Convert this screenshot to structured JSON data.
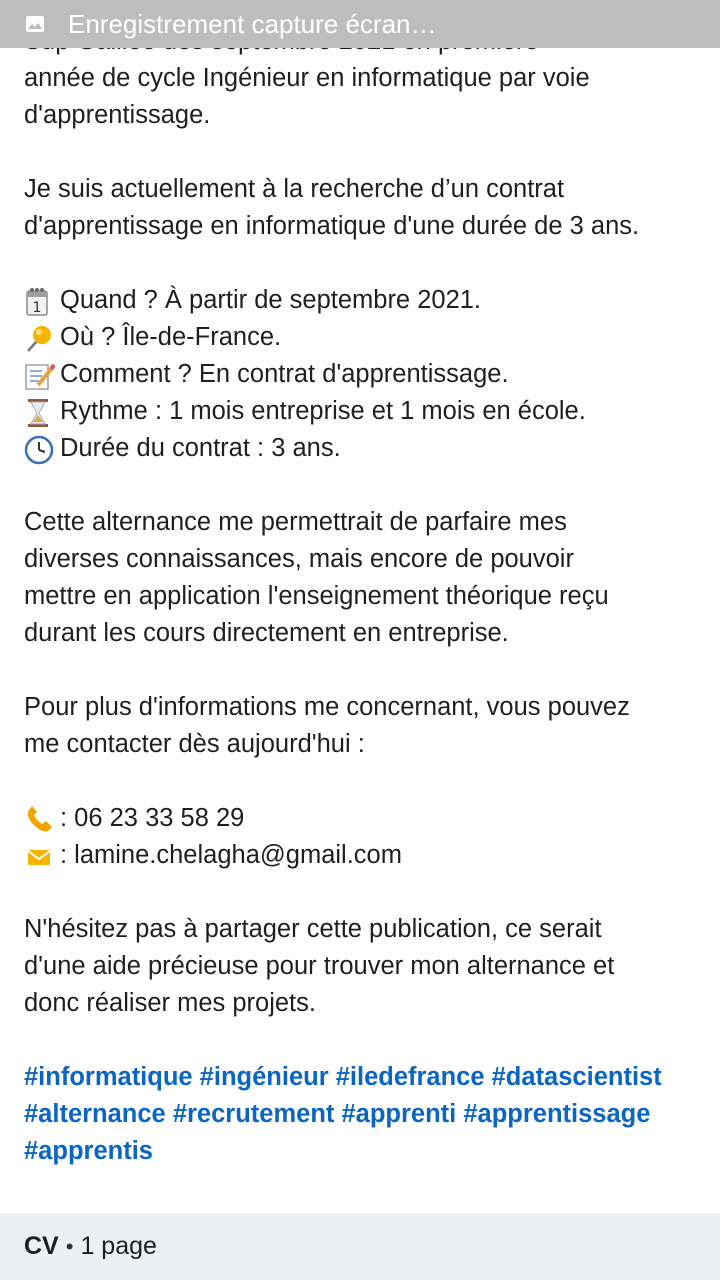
{
  "notification": {
    "icon": "image-icon",
    "title": "Enregistrement capture écran…"
  },
  "post": {
    "lines": [
      "Sup Galilée dés septembre 2021 en première",
      "année de cycle Ingénieur en informatique par voie",
      "d'apprentissage.",
      "Je suis actuellement à la recherche d’un contrat",
      "d'apprentissage en informatique d'une durée de 3 ans."
    ],
    "details": [
      {
        "icon": "calendar-icon",
        "text": "Quand ? À partir de septembre 2021."
      },
      {
        "icon": "pushpin-icon",
        "text": "Où ? Île-de-France."
      },
      {
        "icon": "memo-icon",
        "text": "Comment ? En contrat d'apprentissage."
      },
      {
        "icon": "hourglass-icon",
        "text": " Rythme : 1 mois entreprise et 1 mois en école."
      },
      {
        "icon": "clock-icon",
        "text": " Durée du contrat : 3 ans."
      }
    ],
    "para2": [
      "Cette alternance me permettrait de parfaire mes",
      "diverses connaissances, mais encore de pouvoir",
      "mettre en application l'enseignement théorique reçu",
      "durant les cours directement en entreprise."
    ],
    "para3": [
      "Pour plus d'informations me concernant, vous pouvez",
      "me contacter dès aujourd'hui :"
    ],
    "contacts": [
      {
        "icon": "phone-icon",
        "text": " :  06 23 33 58 29"
      },
      {
        "icon": "envelope-icon",
        "text": " : lamine.chelagha@gmail.com"
      }
    ],
    "para4": [
      "N'hésitez pas à partager cette publication, ce serait",
      "d'une aide précieuse pour trouver mon alternance et",
      "donc réaliser mes projets."
    ],
    "hashtags": [
      "#informatique #ingénieur #iledefrance #datascientist",
      "#alternance #recrutement #apprenti #apprentissage",
      "#apprentis"
    ]
  },
  "document": {
    "type": "CV",
    "separator": "•",
    "pages": "1 page"
  },
  "colors": {
    "hashtag": "#0a66c2",
    "footer_bg": "#edf0f3",
    "notification_bg": "#bdbdbd"
  }
}
